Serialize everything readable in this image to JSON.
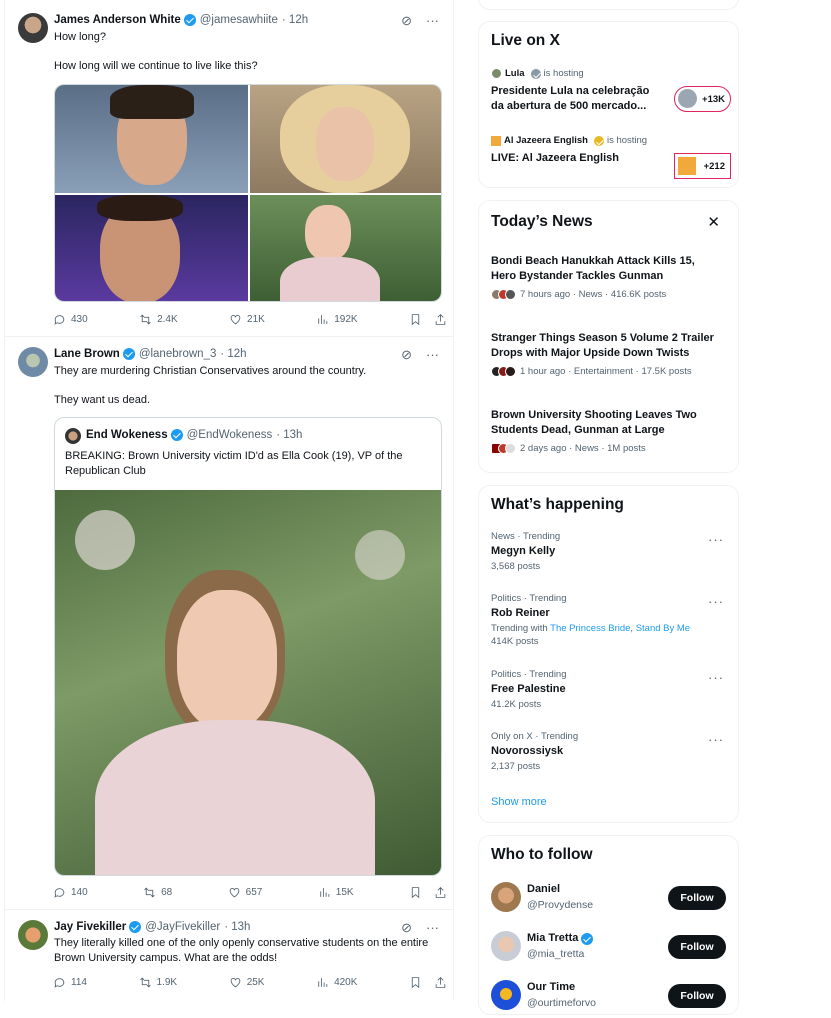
{
  "tweets": [
    {
      "name": "James Anderson White",
      "handle": "@jamesawhiite",
      "time": "· 12h",
      "text": "How long?\n\nHow long will we continue to live like this?",
      "replies": "430",
      "reposts": "2.4K",
      "likes": "21K",
      "views": "192K"
    },
    {
      "name": "Lane Brown",
      "handle": "@lanebrown_3",
      "time": "· 12h",
      "text": "They are murdering Christian Conservatives around the country.\n\nThey want us dead.",
      "quote": {
        "name": "End Wokeness",
        "handle": "@EndWokeness",
        "time": "· 13h",
        "text": "BREAKING: Brown University victim ID'd as Ella Cook (19), VP of the Republican Club"
      },
      "replies": "140",
      "reposts": "68",
      "likes": "657",
      "views": "15K"
    },
    {
      "name": "Jay Fivekiller",
      "handle": "@JayFivekiller",
      "time": "· 13h",
      "text": "They literally killed one of the only openly conservative students on the entire Brown University campus. What are the odds!",
      "replies": "114",
      "reposts": "1.9K",
      "likes": "25K",
      "views": "420K"
    }
  ],
  "live": {
    "title": "Live on X",
    "items": [
      {
        "host": "Lula",
        "hosting": "is hosting",
        "title": "Presidente Lula na celebração da abertura de 500 mercado...",
        "count": "+13K"
      },
      {
        "host": "Al Jazeera English",
        "hosting": "is hosting",
        "title": "LIVE: Al Jazeera English",
        "count": "+212"
      }
    ]
  },
  "news": {
    "title": "Today’s News",
    "items": [
      {
        "headline": "Bondi Beach Hanukkah Attack Kills 15, Hero Bystander Tackles Gunman",
        "meta": "7 hours ago · News · 416.6K posts"
      },
      {
        "headline": "Stranger Things Season 5 Volume 2 Trailer Drops with Major Upside Down Twists",
        "meta": "1 hour ago · Entertainment · 17.5K posts"
      },
      {
        "headline": "Brown University Shooting Leaves Two Students Dead, Gunman at Large",
        "meta": "2 days ago · News · 1M posts"
      }
    ]
  },
  "happening": {
    "title": "What’s happening",
    "items": [
      {
        "category": "News · Trending",
        "topic": "Megyn Kelly",
        "posts": "3,568 posts"
      },
      {
        "category": "Politics · Trending",
        "topic": "Rob Reiner",
        "with_label": "Trending with",
        "with1": "The Princess Bride",
        "with2": "Stand By Me",
        "posts": "414K posts"
      },
      {
        "category": "Politics · Trending",
        "topic": "Free Palestine",
        "posts": "41.2K posts"
      },
      {
        "category": "Only on X · Trending",
        "topic": "Novorossiysk",
        "posts": "2,137 posts"
      }
    ],
    "show_more": "Show more"
  },
  "who": {
    "title": "Who to follow",
    "follow_label": "Follow",
    "items": [
      {
        "name": "Daniel",
        "handle": "@Provydense"
      },
      {
        "name": "Mia Tretta",
        "handle": "@mia_tretta"
      },
      {
        "name": "Our Time",
        "handle": "@ourtimeforvo"
      }
    ]
  },
  "colors": {
    "accent": "#1d9bf0",
    "text": "#0f1419",
    "muted": "#536471",
    "live_border": "#e0245e"
  }
}
